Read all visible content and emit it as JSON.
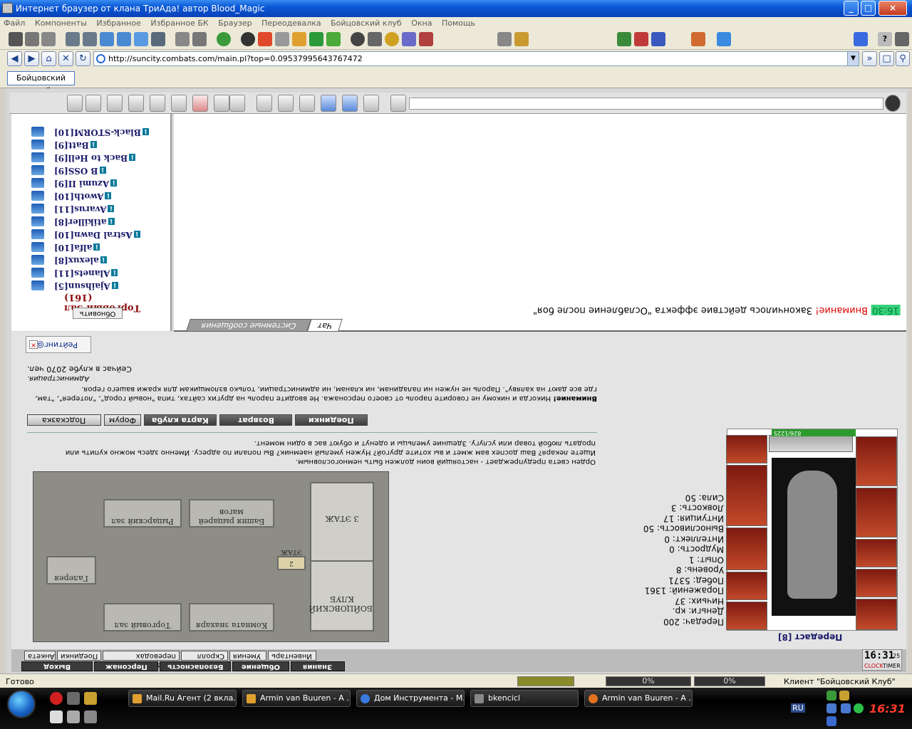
{
  "window": {
    "title": "Интернет браузер от клана ТриАда! автор Blood_Magic",
    "controls": [
      "_",
      "□",
      "×"
    ]
  },
  "menu": [
    "Файл",
    "Компоненты",
    "Избранное",
    "Избранное БК",
    "Браузер",
    "Переодевалка",
    "Бойцовский клуб",
    "Окна",
    "Помощь"
  ],
  "address": {
    "url": "http://suncity.combats.com/main.pl?top=0.09537995643767472"
  },
  "tabs": [
    {
      "label": "Бойцовский клуб"
    }
  ],
  "online_list": {
    "room_title": "Торговый Зал (161)",
    "refresh_label": "Обновить",
    "players": [
      "Black-STORM[10]",
      "Batt[9]",
      "Back to Hell[9]",
      "B OSS[9]",
      "Azumi II[9]",
      "Awoth[10]",
      "Avarus[11]",
      "atikiller[8]",
      "Astral Dawn[10]",
      "alfa[10]",
      "alexux[8]",
      "Alanets[11]",
      "Ajaihsun[5]"
    ]
  },
  "chat": {
    "time": "16:30",
    "warning": "Внимание!",
    "message": "Закончилось действие эффекта \"Ослабление после боя\"",
    "tab_chat": "Чат",
    "tab_system": "Системные сообщения"
  },
  "game": {
    "rating_tab": "Рейтинг@",
    "online_count": "Сейчас в клубе 2070 чел.",
    "admin": "Администрация.",
    "warn_title": "Внимание!",
    "warn_text": "Никогда и никому не говорите пароль от своего персонажа. Не вводите пароль на других сайтах, типа \"новый город\", \"лотерея\", \"там, где все дают на халяву\". Пароль не нужен ни паладинам, ни кланам, ни администрации, только взломщикам для кражи вашего героя.",
    "buttons": {
      "fights": "Поединки",
      "back": "Возврат",
      "map": "Карта клуба",
      "forum": "Форум",
      "hint": "Подсказка"
    },
    "lore_1": "Ищете лекаря? Ваш доспех вам жмет и вы хотите другой? Нужен умелый наемник? Вы попали по адресу. Именно здесь можно купить или продать любой товар или услугу. Здешние умельцы и оденут и обуют вас в один момент.",
    "lore_2": "Орден света предупреждает - настоящий воин должен быть немногословным.",
    "map_rooms": {
      "floor2": "2 ЭТАЖ",
      "floor3": "3 ЭТАЖ",
      "club": "БОЙЦОВСКИЙ КЛУБ",
      "healers": "Комната знахаря",
      "trade": "Торговый зал",
      "knights": "Рыцарский зал",
      "tower": "Башня рыцарей магов",
      "gallery": "Галерея"
    }
  },
  "character": {
    "name": "Передаст [8]",
    "hp": "826/1225",
    "stats": {
      "strength": "Сила: 50",
      "agility": "Ловкость: 3",
      "intuition": "Интуиция: 17",
      "endurance": "Выносливость: 50",
      "intellect": "Интеллект: 0",
      "wisdom": "Мудрость: 0",
      "exp": "Опыт: 1",
      "level": "Уровень: 8",
      "wins": "Побед: 5371",
      "losses": "Поражений: 1361",
      "draws": "Ничьих: 37",
      "money": "Деньги:",
      "money_unit": "кр.",
      "transfers": "Передач: 200"
    }
  },
  "bottom_nav": {
    "row1": [
      "Анкета",
      "Поединки",
      "Отчет о переводах",
      "Мой Скролл",
      "Умения",
      "Инвентарь"
    ],
    "row2": [
      "Выход",
      "Персонаж",
      "Безопасность",
      "Общение",
      "Знания"
    ],
    "clock_time": "16:31",
    "clock_sec": "25",
    "clock_label": "CLOCK",
    "timer_label": "TIMER"
  },
  "status": {
    "ready": "Готово",
    "p1": "0%",
    "p2": "0%",
    "client": "Клиент \"Бойцовский Клуб\""
  },
  "taskbar": {
    "tasks": [
      "Mail.Ru Агент (2 вкла...",
      "Armin van Buuren - A ...",
      "Дом Инструмента - М...",
      "bkencicl",
      "Armin van Buuren - A ..."
    ],
    "lang": "RU",
    "time": "16:31"
  },
  "colors": {
    "title_bar": "#0a58d6",
    "chat_time_bg": "#38d07a",
    "warning_red": "#dd0000",
    "player_name": "#1a1a6a",
    "room_title": "#8a0a0a"
  }
}
